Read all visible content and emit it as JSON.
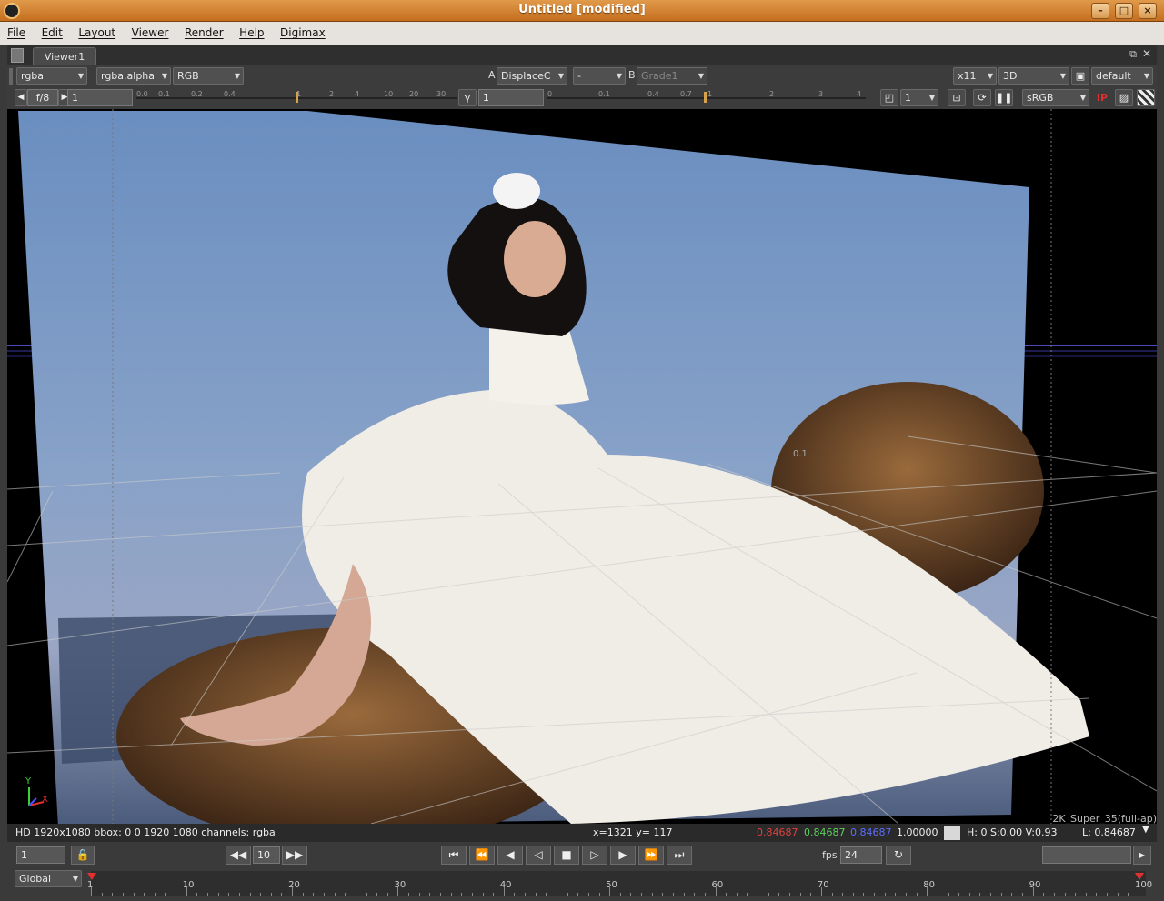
{
  "window": {
    "title": "Untitled [modified]"
  },
  "menu": [
    "File",
    "Edit",
    "Layout",
    "Viewer",
    "Render",
    "Help",
    "Digimax"
  ],
  "tabs": {
    "viewer": "Viewer1"
  },
  "toolbar1": {
    "channels": "rgba",
    "alpha": "rgba.alpha",
    "colorspace": "RGB",
    "a_label": "A",
    "a_input": "DisplaceC",
    "compare_op": "-",
    "b_label": "B",
    "b_input": "Grade1",
    "display": "x11",
    "view_mode": "3D",
    "camera": "default"
  },
  "toolbar2": {
    "fstop": "f/8",
    "gain": "1",
    "gamma_label": "γ",
    "gamma": "1",
    "proxy": "1",
    "lut": "sRGB",
    "ip_label": "IP"
  },
  "gain_ticks": [
    "0.0",
    "0.1",
    "0.2",
    "0.4",
    "1",
    "2",
    "4",
    "10",
    "20",
    "30"
  ],
  "gamma_ticks": [
    "0",
    "0.1",
    "0.4",
    "0.7",
    "1",
    "2",
    "3",
    "4"
  ],
  "viewer": {
    "format_label": "2K_Super_35(full-ap)",
    "grid_label": "0.1",
    "axis_y": "Y",
    "axis_x": "X"
  },
  "status": {
    "info": "HD 1920x1080 bbox: 0 0 1920 1080 channels: rgba",
    "coords": "x=1321 y= 117",
    "r": "0.84687",
    "g": "0.84687",
    "b": "0.84687",
    "a": "1.00000",
    "hsv": "H:   0 S:0.00 V:0.93",
    "lum": "L: 0.84687",
    "colors": {
      "r": "#e04040",
      "g": "#5cd05c",
      "b": "#5a6cff"
    }
  },
  "playback": {
    "frame": "1",
    "skip": "10",
    "fps_label": "fps",
    "fps": "24"
  },
  "timeline": {
    "scope": "Global",
    "start": "1",
    "end": "100",
    "marks": [
      "1",
      "10",
      "20",
      "30",
      "40",
      "50",
      "60",
      "70",
      "80",
      "90",
      "100"
    ]
  }
}
